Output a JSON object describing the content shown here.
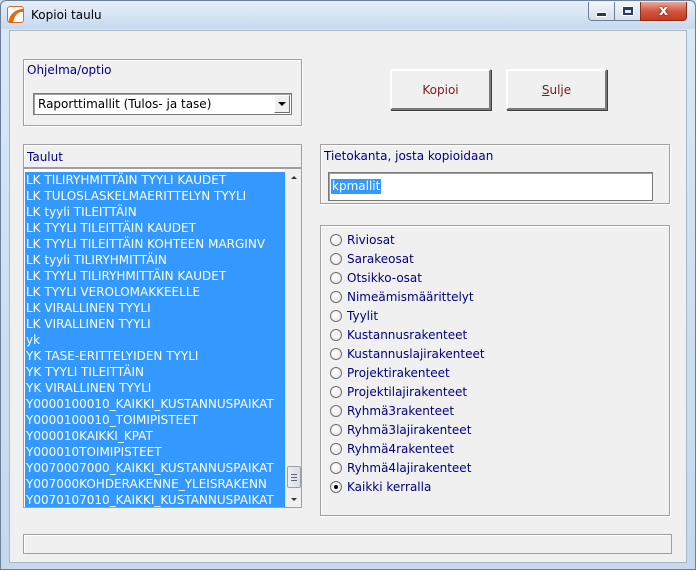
{
  "window": {
    "title": "Kopioi taulu",
    "controls": {
      "minimize": "",
      "maximize": "",
      "close": "x"
    }
  },
  "program": {
    "label": "Ohjelma/optio",
    "selected": "Raporttimallit (Tulos- ja tase)"
  },
  "buttons": {
    "copy_label": "Kopioi",
    "close_label_prefix": "",
    "close_label_underlined": "S",
    "close_label_rest": "ulje"
  },
  "tables": {
    "header": "Taulut",
    "items": [
      "LK TILIRYHMITTÄIN TYYLI KAUDET",
      "LK TULOSLASKELMAERITTELYN TYYLI",
      "LK tyyli TILEITTÄIN",
      "LK TYYLI TILEITTÄIN KAUDET",
      "LK TYYLI TILEITTÄIN KOHTEEN MARGINV",
      "LK tyyli TILIRYHMITTÄIN",
      "LK TYYLI TILIRYHMITTÄIN KAUDET",
      "LK TYYLI VEROLOMAKKEELLE",
      "LK VIRALLINEN  TYYLI",
      "LK VIRALLINEN TYYLI",
      "yk",
      "YK TASE-ERITTELYIDEN TYYLI",
      "YK TYYLI TILEITTÄIN",
      "YK VIRALLINEN TYYLI",
      "Y0000100010_KAIKKI_KUSTANNUSPAIKAT",
      "Y0000100010_TOIMIPISTEET",
      "Y000010KAIKKI_KPAT",
      "Y000010TOIMIPISTEET",
      "Y0070007000_KAIKKI_KUSTANNUSPAIKAT",
      "Y007000KOHDERAKENNE_YLEISRAKENN",
      "Y0070107010_KAIKKI_KUSTANNUSPAIKAT"
    ]
  },
  "database": {
    "label": "Tietokanta, josta kopioidaan",
    "value": "kpmallit"
  },
  "options": {
    "items": [
      {
        "label": "Riviosat",
        "checked": false
      },
      {
        "label": "Sarakeosat",
        "checked": false
      },
      {
        "label": "Otsikko-osat",
        "checked": false
      },
      {
        "label": "Nimeämismäärittelyt",
        "checked": false
      },
      {
        "label": "Tyylit",
        "checked": false
      },
      {
        "label": "Kustannusrakenteet",
        "checked": false
      },
      {
        "label": "Kustannuslajirakenteet",
        "checked": false
      },
      {
        "label": "Projektirakenteet",
        "checked": false
      },
      {
        "label": "Projektilajirakenteet",
        "checked": false
      },
      {
        "label": "Ryhmä3rakenteet",
        "checked": false
      },
      {
        "label": "Ryhmä3lajirakenteet",
        "checked": false
      },
      {
        "label": "Ryhmä4rakenteet",
        "checked": false
      },
      {
        "label": "Ryhmä4lajirakenteet",
        "checked": false
      },
      {
        "label": "Kaikki kerralla",
        "checked": true
      }
    ]
  },
  "status": {
    "text": ""
  }
}
